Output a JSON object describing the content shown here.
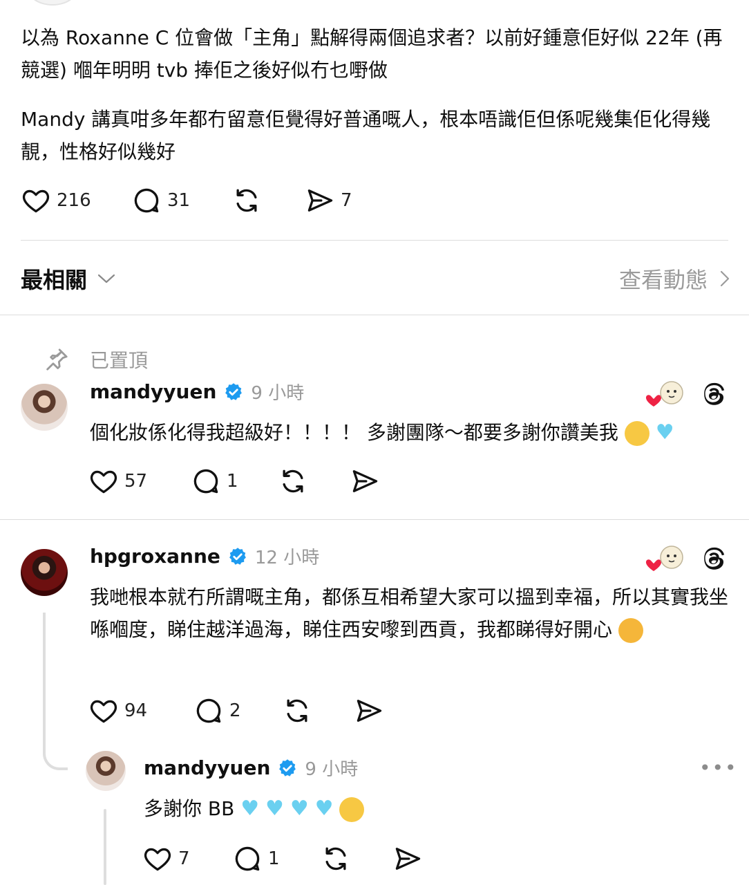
{
  "post": {
    "paragraph1": "以為 Roxanne C 位會做「主角」點解得兩個追求者？以前好鍾意佢好似 22年 (再競選) 嗰年明明 tvb 捧佢之後好似冇乜嘢做",
    "paragraph2": "Mandy 講真咁多年都冇留意佢覺得好普通嘅人，根本唔識佢但係呢幾集佢化得幾靚，性格好似幾好",
    "likes": "216",
    "comments": "31",
    "shares": "7"
  },
  "sort": {
    "label": "最相關",
    "view_activity": "查看動態"
  },
  "replies": [
    {
      "pinned_label": "已置頂",
      "username": "mandyyuen",
      "time": "9 小時",
      "text": "個化妝係化得我超級好！！！！ 多謝團隊～都要多謝你讚美我",
      "likes": "57",
      "comments": "1"
    },
    {
      "username": "hpgroxanne",
      "time": "12 小時",
      "text": "我哋根本就冇所謂嘅主角，都係互相希望大家可以搵到幸福，所以其實我坐喺嗰度，睇住越洋過海，睇住西安嚟到西貢，我都睇得好開心",
      "likes": "94",
      "comments": "2"
    },
    {
      "username": "mandyyuen",
      "time": "9 小時",
      "text": "多謝你 BB",
      "likes": "7",
      "comments": "1"
    }
  ],
  "colors": {
    "verified": "#1d9bf0",
    "muted": "#999999",
    "text": "#101010",
    "blue_heart": "#6ad0f0"
  }
}
